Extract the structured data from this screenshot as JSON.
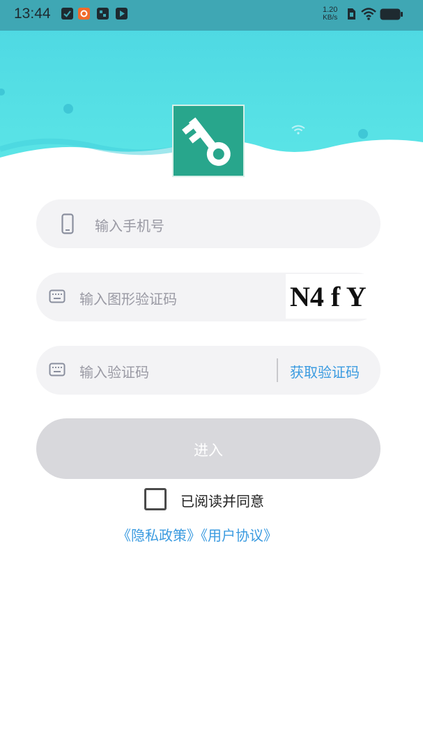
{
  "status_bar": {
    "time": "13:44",
    "net_speed_value": "1.20",
    "net_speed_unit": "KB/s"
  },
  "form": {
    "phone_placeholder": "输入手机号",
    "captcha_placeholder": "输入图形验证码",
    "captcha_image_text": "N4 f Y",
    "code_placeholder": "输入验证码",
    "get_code_label": "获取验证码"
  },
  "enter_button": {
    "label": "进入"
  },
  "agreement": {
    "checked": false,
    "label": "已阅读并同意",
    "privacy_policy": "《隐私政策》",
    "user_agreement": "《用户协议》"
  },
  "colors": {
    "header_teal": "#4fd9e3",
    "logo_green": "#28a68c",
    "link_blue": "#3b9be0",
    "button_disabled": "#d8d8dc"
  }
}
